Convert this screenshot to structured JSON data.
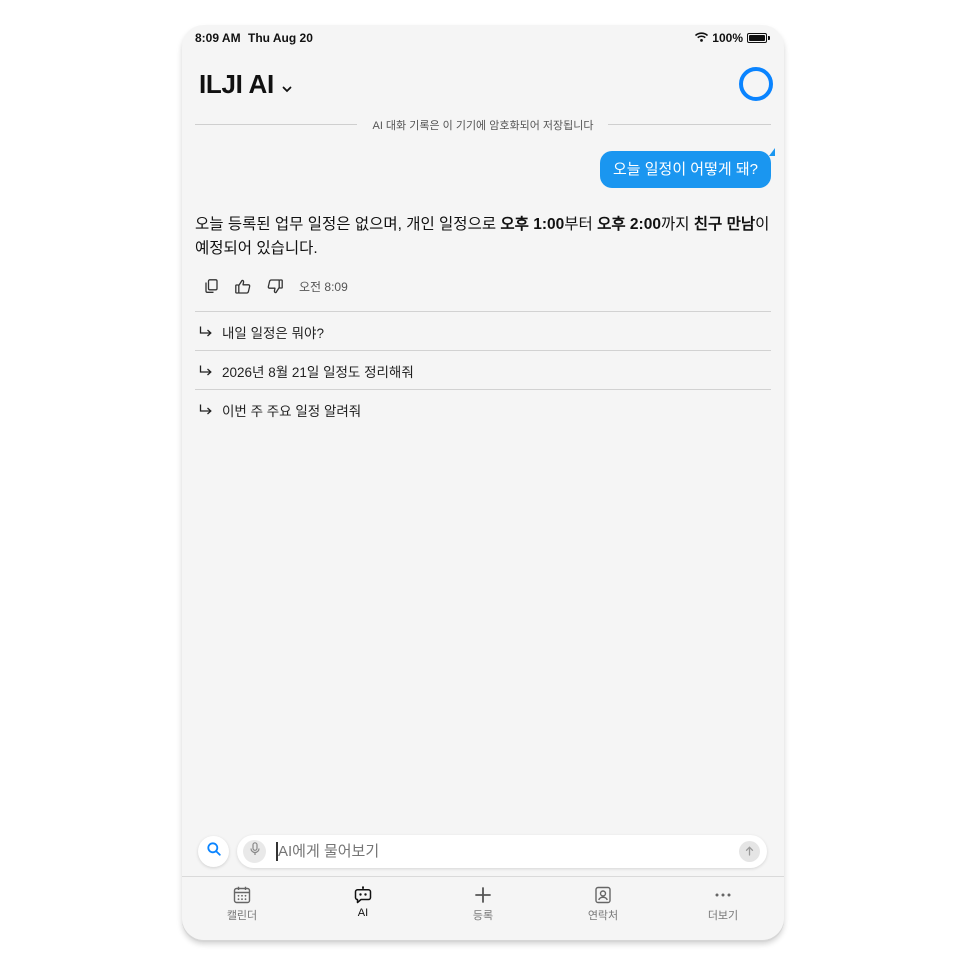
{
  "status_bar": {
    "time": "8:09 AM",
    "date": "Thu Aug 20",
    "battery": "100%"
  },
  "header": {
    "title": "ILJI AI"
  },
  "notice": "AI 대화 기록은 이 기기에 암호화되어 저장됩니다",
  "user_message": "오늘 일정이 어떻게 돼?",
  "ai_message": {
    "parts": [
      {
        "text": "오늘 등록된 업무 일정은 없으며, 개인 일정으로 ",
        "bold": false
      },
      {
        "text": "오후 1:00",
        "bold": true
      },
      {
        "text": "부터 ",
        "bold": false
      },
      {
        "text": "오후 2:00",
        "bold": true
      },
      {
        "text": "까지 ",
        "bold": false
      },
      {
        "text": "친구 만남",
        "bold": true
      },
      {
        "text": "이 예정되어 있습니다.",
        "bold": false
      }
    ],
    "time": "오전 8:09"
  },
  "suggestions": [
    "내일 일정은 뭐야?",
    "2026년 8월 21일 일정도 정리해줘",
    "이번 주 주요 일정 알려줘"
  ],
  "input": {
    "placeholder": "AI에게 물어보기"
  },
  "tabs": [
    {
      "label": "캘린더",
      "icon": "calendar-icon",
      "active": false
    },
    {
      "label": "AI",
      "icon": "ai-bot-icon",
      "active": true
    },
    {
      "label": "등록",
      "icon": "plus-icon",
      "active": false
    },
    {
      "label": "연락처",
      "icon": "contacts-icon",
      "active": false
    },
    {
      "label": "더보기",
      "icon": "more-icon",
      "active": false
    }
  ],
  "colors": {
    "accent": "#0a84ff",
    "bubble": "#1a96f0",
    "background": "#f5f5f5"
  }
}
